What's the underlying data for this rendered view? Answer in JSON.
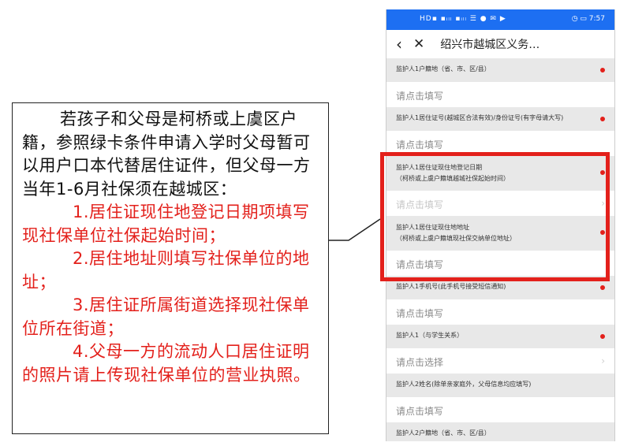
{
  "note": {
    "intro": "若孩子和父母是柯桥或上虞区户籍，参照绿卡条件申请入学时父母暂可以用户口本代替居住证件，但父母一方当年1-6月社保须在越城区：",
    "items": [
      "1.居住证现住地登记日期项填写现社保单位社保起始时间；",
      "2.居住地址则填写社保单位的地址；",
      "3.居住证所属街道选择现社保单位所在街道；",
      "4.父母一方的流动人口居住证明的照片请上传现社保单位的营业执照。"
    ]
  },
  "phone": {
    "status_left": "HD▪ ▪ᵢₗₗ ▪ᵢₗₗ ☰ ● ✉ ▶",
    "status_right": "◷ ▭ 7:57",
    "nav": {
      "back_icon": "‹",
      "close_icon": "✕",
      "title": "绍兴市越城区义务…"
    },
    "fields": [
      {
        "label": "监护人1户籍地（省、市、区/县）",
        "sublabel": "",
        "input": "请点击填写",
        "required": true,
        "type": "text"
      },
      {
        "label": "监护人1居住证号(越城区合法有效)/身份证号(有字母请大写)",
        "sublabel": "",
        "input": "请点击填写",
        "required": true,
        "type": "text"
      },
      {
        "label": "监护人1居住证现住地登记日期",
        "sublabel": "（柯桥或上虞户籍填越城社保起始时间）",
        "input": "请点击填写",
        "required": true,
        "type": "date"
      },
      {
        "label": "监护人1居住证现住地地址",
        "sublabel": "（柯桥或上虞户籍填现社保交纳单位地址）",
        "input": "请点击填写",
        "required": true,
        "type": "text"
      },
      {
        "label": "监护人1手机号(此手机号接受短信通知)",
        "sublabel": "",
        "input": "请点击填写",
        "required": true,
        "type": "text"
      },
      {
        "label": "监护人1（与学生关系）",
        "sublabel": "",
        "input": "请点击选择",
        "required": true,
        "type": "select"
      },
      {
        "label": "监护人2姓名(除单亲家庭外，父母信息均应填写)",
        "sublabel": "",
        "input": "请点击填写",
        "required": false,
        "type": "text"
      },
      {
        "label": "监护人2户籍地（省、市、区/县）",
        "sublabel": "",
        "input": "",
        "required": false,
        "type": "text"
      }
    ]
  },
  "colors": {
    "accent_blue": "#1d6ff2",
    "highlight_red": "#e3201b",
    "label_bg": "#e8e8e8"
  }
}
